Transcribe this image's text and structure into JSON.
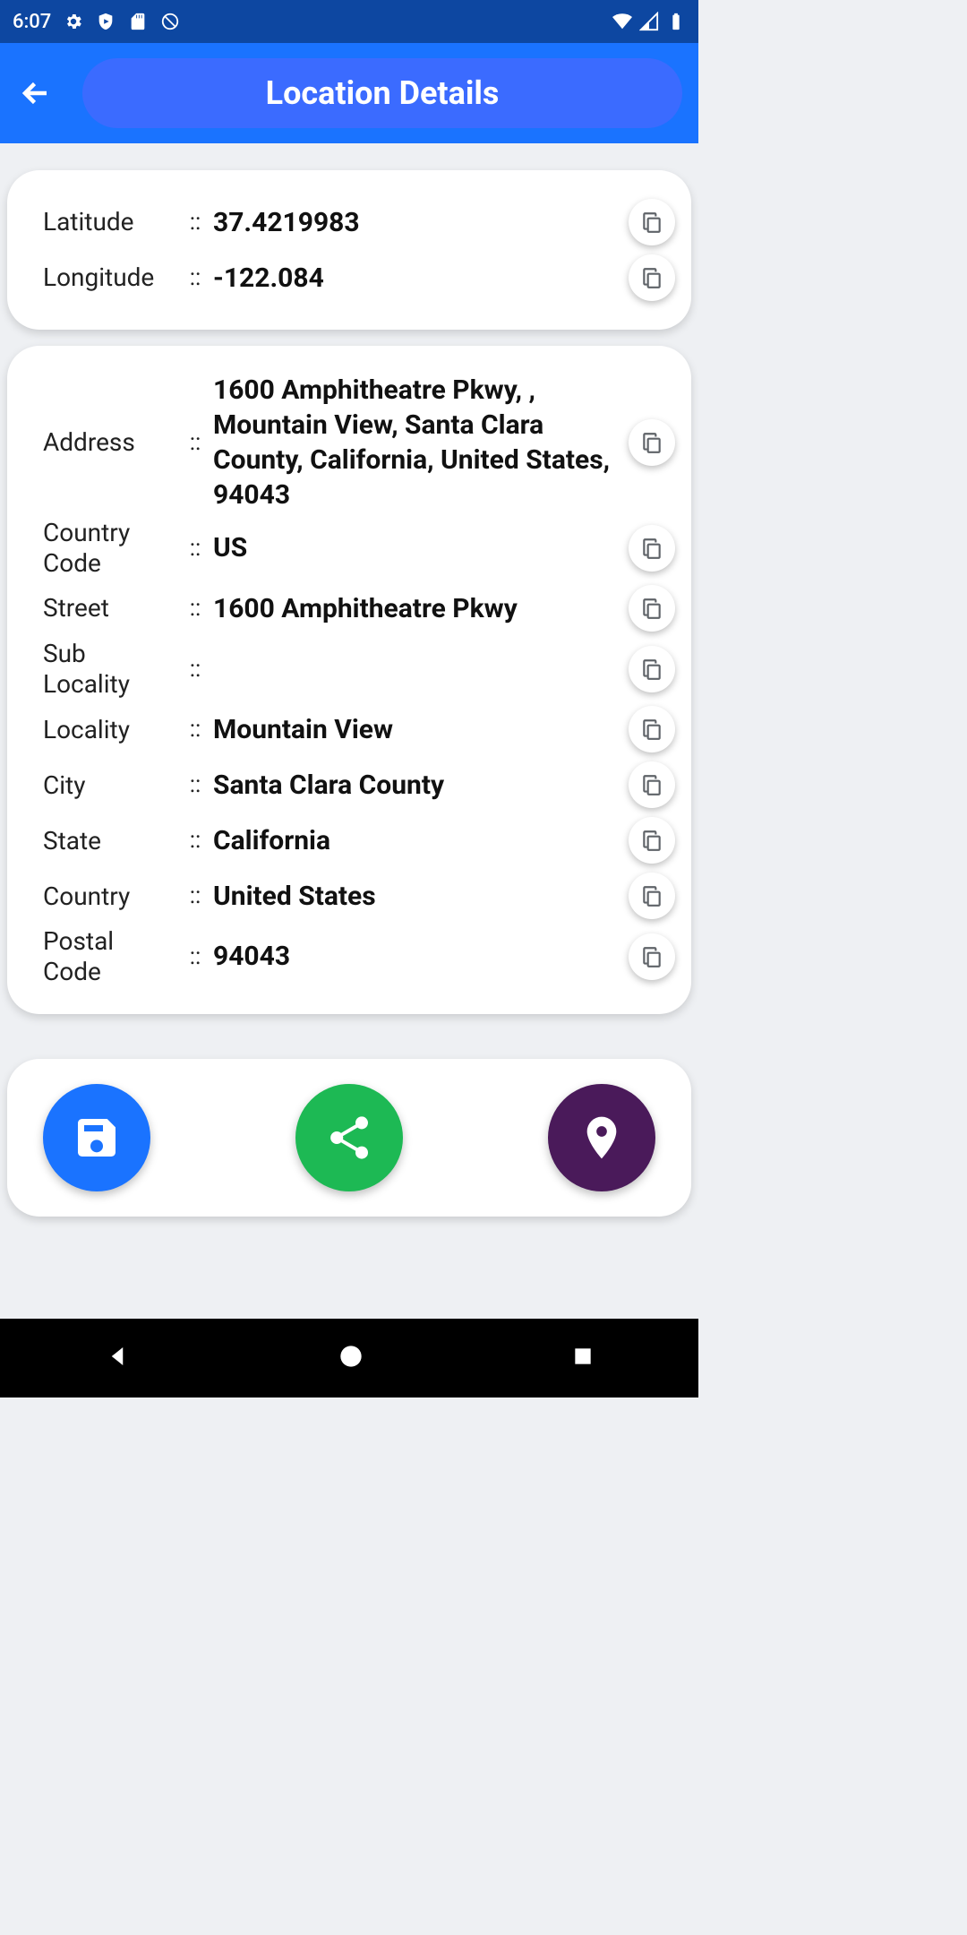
{
  "status": {
    "time": "6:07"
  },
  "header": {
    "title": "Location Details"
  },
  "sep": "::",
  "coords": {
    "lat_label": "Latitude",
    "lat_value": "37.4219983",
    "lon_label": "Longitude",
    "lon_value": "-122.084"
  },
  "addr": {
    "address_label": "Address",
    "address_value": "1600 Amphitheatre Pkwy, , Mountain View, Santa Clara County, California, United States, 94043",
    "cc_label": "Country Code",
    "cc_value": "US",
    "street_label": "Street",
    "street_value": "1600 Amphitheatre Pkwy",
    "subloc_label": "Sub Locality",
    "subloc_value": "",
    "loc_label": "Locality",
    "loc_value": "Mountain View",
    "city_label": "City",
    "city_value": "Santa Clara County",
    "state_label": "State",
    "state_value": "California",
    "country_label": "Country",
    "country_value": "United States",
    "postal_label": "Postal Code",
    "postal_value": "94043"
  },
  "colors": {
    "status_bar": "#0d47a1",
    "app_bar": "#1a73ff",
    "title_pill": "#3b6bff",
    "fab_save": "#1a73ff",
    "fab_share": "#1db954",
    "fab_pin": "#4a1a5a"
  }
}
